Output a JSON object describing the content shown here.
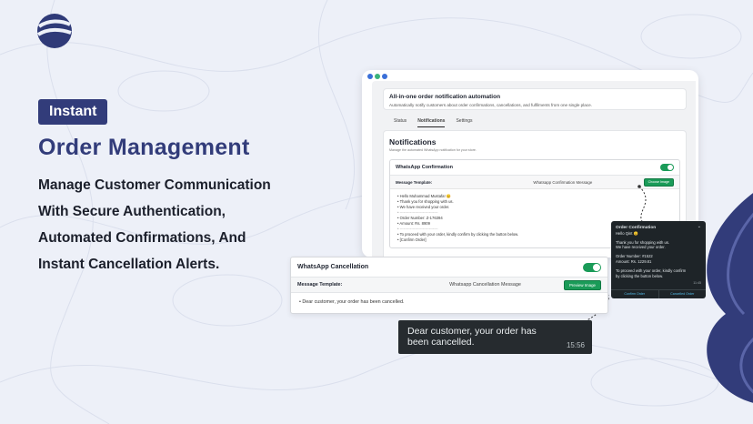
{
  "brand": {
    "accent": "#323c7a",
    "green": "#1a9b58"
  },
  "badge": "Instant",
  "headline": "Order Management",
  "description": [
    "Manage Customer Communication",
    "With Secure Authentication,",
    "Automated Confirmations, And",
    "Instant Cancellation Alerts."
  ],
  "app": {
    "hero_title": "All-in-one order notification automation",
    "hero_sub": "Automatically notify customers about order confirmations, cancellations, and fulfilments from one single place.",
    "tabs": [
      "Status",
      "Notifications",
      "Settings"
    ],
    "active_tab": "Notifications",
    "notifications_title": "Notifications",
    "notifications_sub": "Manage the automated WhatsApp notification for your store.",
    "confirmation": {
      "title": "WhatsApp Confirmation",
      "enabled": true,
      "template_label": "Message Template:",
      "template_name": "Whatsapp Confirmation Message",
      "button": "Choose Image",
      "lines": [
        "Hello Muhammad Mustafa! 😊",
        "Thank you for shopping with us.",
        "We have received your order.",
        "------------------------------",
        "Order Number: Z-176394",
        "Amount: Rs. 8909",
        "------------------------------",
        "To proceed with your order, kindly confirm by clicking the button below.",
        "[Confirm Order]"
      ]
    }
  },
  "cancellation": {
    "title": "WhatsApp Cancellation",
    "enabled": true,
    "template_label": "Message Template:",
    "template_name": "Whatsapp Cancellation Message",
    "button": "Preview Image",
    "message": "Dear customer, your order has been cancelled."
  },
  "cancel_bubble": {
    "text": "Dear customer, your order has been cancelled.",
    "time": "15:56"
  },
  "confirm_bubble": {
    "title": "Order Confirmation",
    "lines": [
      "Hello Qint 😊",
      "",
      "Thank you for shopping with us.",
      "We have received your order.",
      "",
      "Order Number: #1522",
      "Amount: Rs. 1229.81",
      "",
      "To proceed with your order, kindly confirm",
      "by clicking the button below."
    ],
    "time": "11:45",
    "buttons": [
      "Confirm Order",
      "Cancelled Order"
    ]
  }
}
